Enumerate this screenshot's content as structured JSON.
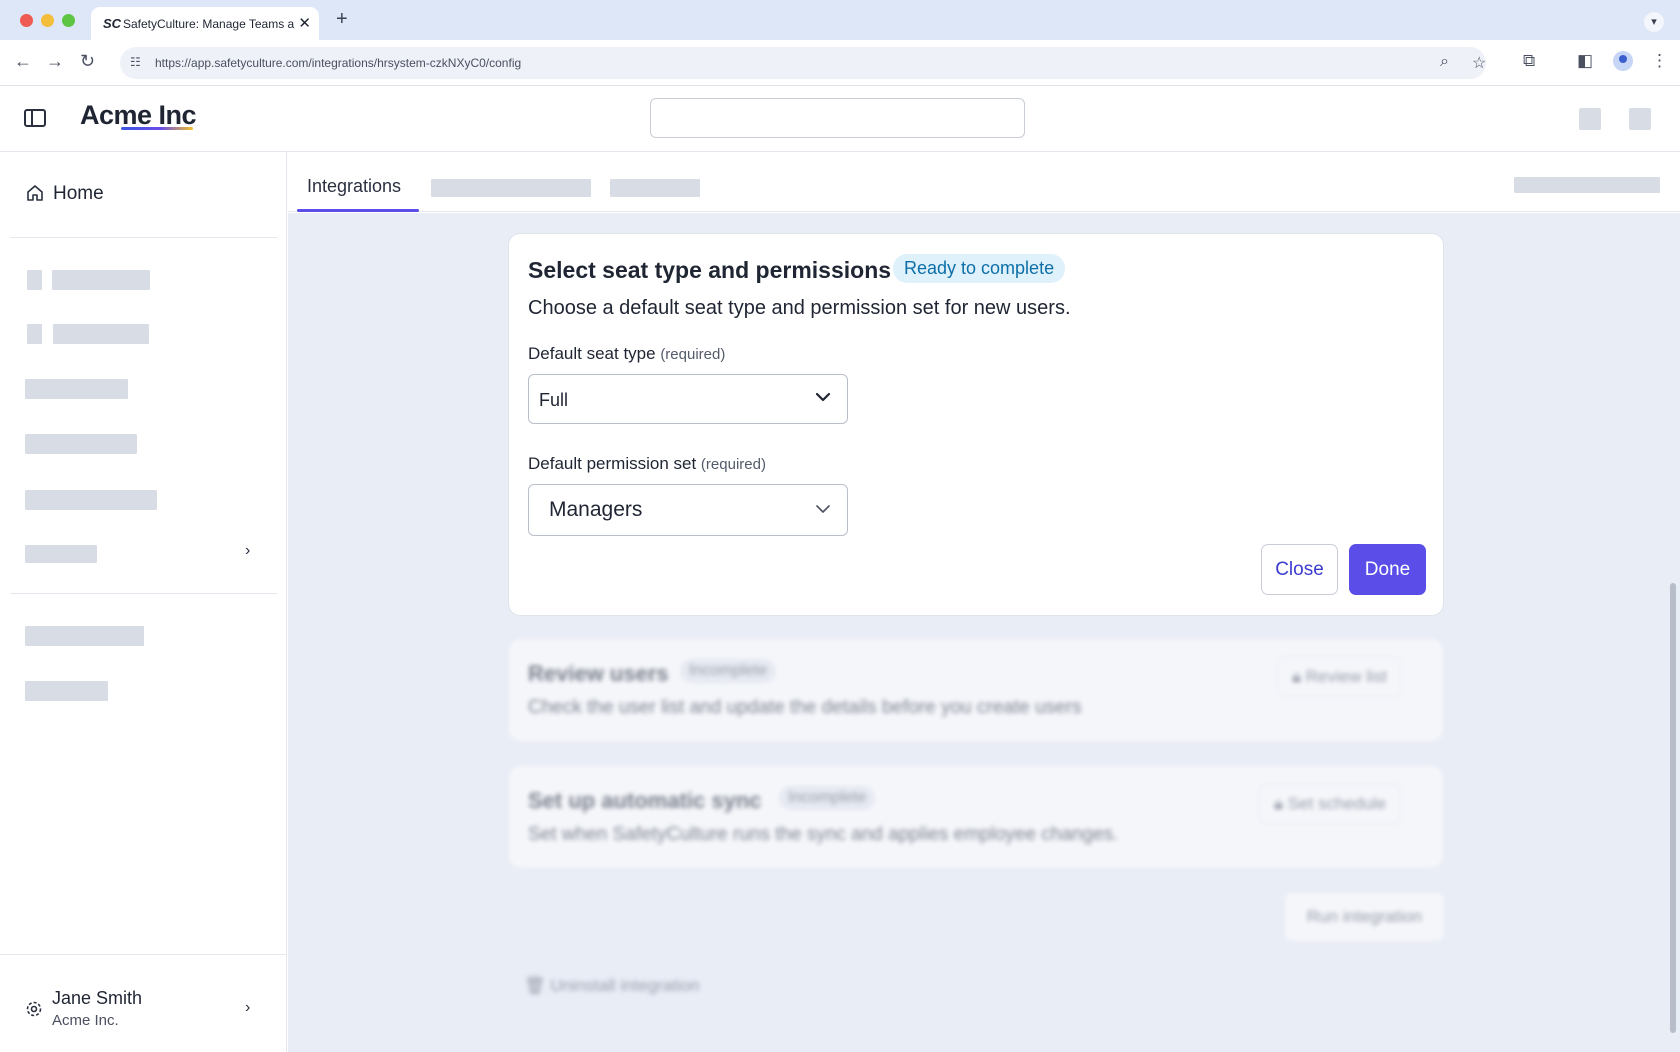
{
  "browser": {
    "tab_title": "SafetyCulture: Manage Teams and...",
    "tab_favicon": "SC",
    "new_tab_label": "+",
    "url": "https://app.safetyculture.com/integrations/hrsystem-czkNXyC0/config"
  },
  "header": {
    "logo": "Acme Inc"
  },
  "sidebar": {
    "home_label": "Home",
    "user_name": "Jane Smith",
    "user_org": "Acme Inc."
  },
  "content": {
    "tabs": [
      {
        "label": "Integrations"
      }
    ]
  },
  "main_card": {
    "title": "Select seat type and permissions",
    "badge": "Ready to complete",
    "description": "Choose a default seat type and permission set for new users.",
    "seat_label": "Default seat type",
    "seat_required": "(required)",
    "seat_value": "Full",
    "perm_label": "Default permission set",
    "perm_required": "(required)",
    "perm_value": "Managers",
    "close_label": "Close",
    "done_label": "Done"
  },
  "review_card": {
    "title": "Review users",
    "badge": "Incomplete",
    "description": "Check the user list and update the details before you create users",
    "button": "Review list"
  },
  "sync_card": {
    "title": "Set up automatic sync",
    "badge": "Incomplete",
    "description": "Set when SafetyCulture runs the sync and applies employee changes.",
    "button": "Set schedule"
  },
  "actions": {
    "run_label": "Run integration",
    "uninstall_label": "Uninstall integration"
  },
  "colors": {
    "accent": "#5a4de8",
    "badge_ready_bg": "#dff1fb",
    "badge_ready_text": "#0d6fa8",
    "panel_bg": "#e9edf6"
  }
}
